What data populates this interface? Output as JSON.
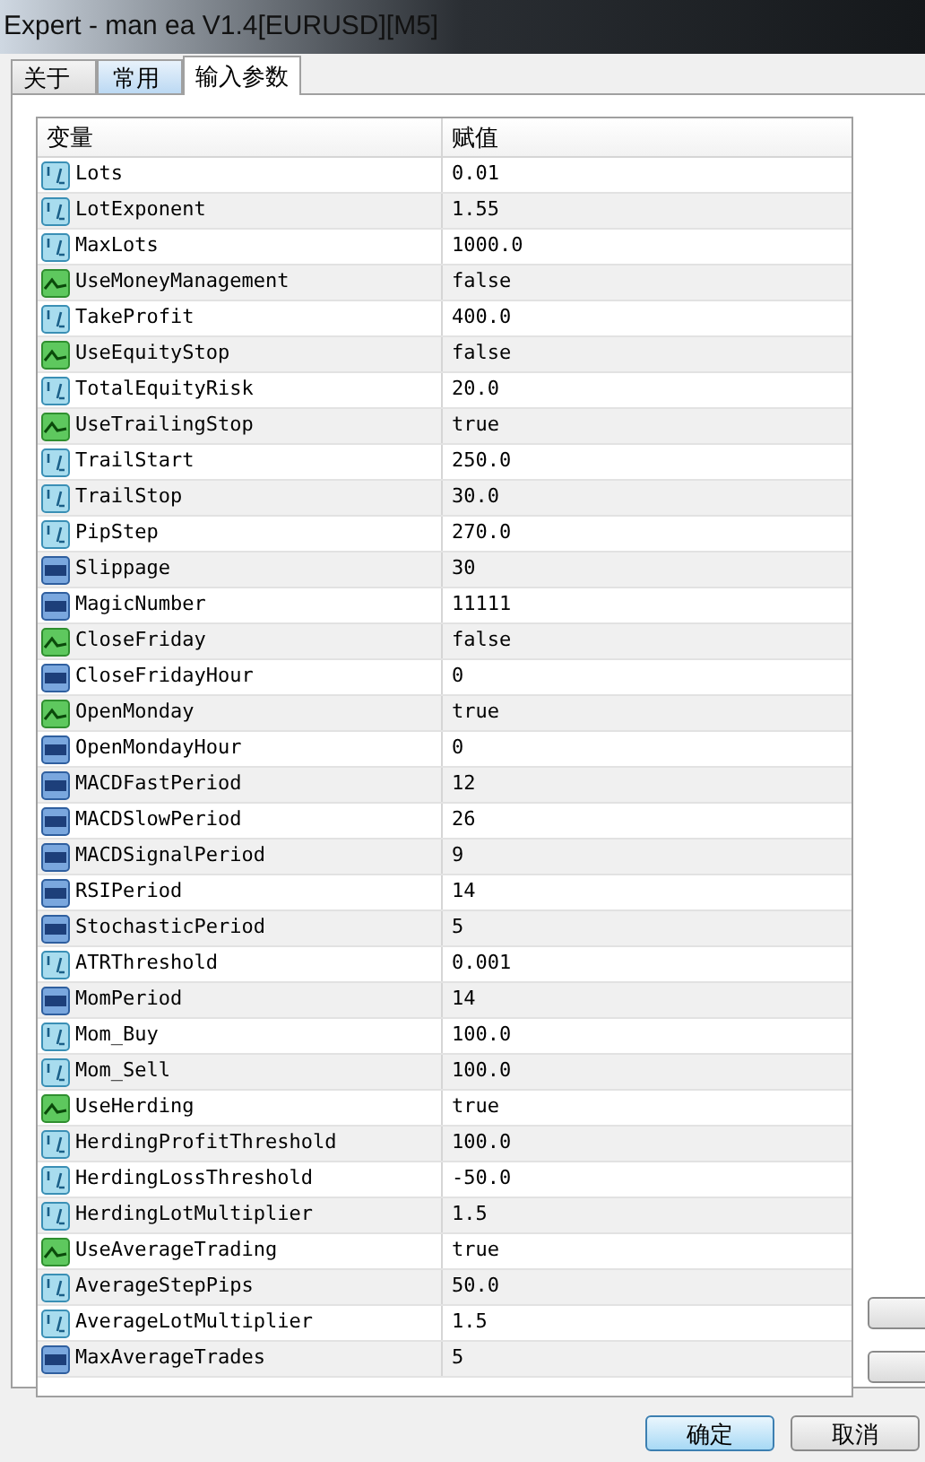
{
  "window": {
    "title": "Expert - man ea V1.4[EURUSD][M5]"
  },
  "tabs": [
    {
      "label": "关于",
      "selected": false
    },
    {
      "label": "常用",
      "selected": false
    },
    {
      "label": "输入参数",
      "selected": true
    }
  ],
  "table": {
    "columns": [
      "变量",
      "赋值"
    ],
    "rows": [
      {
        "kind": "double",
        "name": "Lots",
        "value": "0.01"
      },
      {
        "kind": "double",
        "name": "LotExponent",
        "value": "1.55"
      },
      {
        "kind": "double",
        "name": "MaxLots",
        "value": "1000.0"
      },
      {
        "kind": "bool",
        "name": "UseMoneyManagement",
        "value": "false"
      },
      {
        "kind": "double",
        "name": "TakeProfit",
        "value": "400.0"
      },
      {
        "kind": "bool",
        "name": "UseEquityStop",
        "value": "false"
      },
      {
        "kind": "double",
        "name": "TotalEquityRisk",
        "value": "20.0"
      },
      {
        "kind": "bool",
        "name": "UseTrailingStop",
        "value": "true"
      },
      {
        "kind": "double",
        "name": "TrailStart",
        "value": "250.0"
      },
      {
        "kind": "double",
        "name": "TrailStop",
        "value": "30.0"
      },
      {
        "kind": "double",
        "name": "PipStep",
        "value": "270.0"
      },
      {
        "kind": "int",
        "name": "Slippage",
        "value": "30"
      },
      {
        "kind": "int",
        "name": "MagicNumber",
        "value": "11111"
      },
      {
        "kind": "bool",
        "name": "CloseFriday",
        "value": "false"
      },
      {
        "kind": "int",
        "name": "CloseFridayHour",
        "value": "0"
      },
      {
        "kind": "bool",
        "name": "OpenMonday",
        "value": "true"
      },
      {
        "kind": "int",
        "name": "OpenMondayHour",
        "value": "0"
      },
      {
        "kind": "int",
        "name": "MACDFastPeriod",
        "value": "12"
      },
      {
        "kind": "int",
        "name": "MACDSlowPeriod",
        "value": "26"
      },
      {
        "kind": "int",
        "name": "MACDSignalPeriod",
        "value": "9"
      },
      {
        "kind": "int",
        "name": "RSIPeriod",
        "value": "14"
      },
      {
        "kind": "int",
        "name": "StochasticPeriod",
        "value": "5"
      },
      {
        "kind": "double",
        "name": "ATRThreshold",
        "value": "0.001"
      },
      {
        "kind": "int",
        "name": "MomPeriod",
        "value": "14"
      },
      {
        "kind": "double",
        "name": "Mom_Buy",
        "value": "100.0"
      },
      {
        "kind": "double",
        "name": "Mom_Sell",
        "value": "100.0"
      },
      {
        "kind": "bool",
        "name": "UseHerding",
        "value": "true"
      },
      {
        "kind": "double",
        "name": "HerdingProfitThreshold",
        "value": "100.0"
      },
      {
        "kind": "double",
        "name": "HerdingLossThreshold",
        "value": "-50.0"
      },
      {
        "kind": "double",
        "name": "HerdingLotMultiplier",
        "value": "1.5"
      },
      {
        "kind": "bool",
        "name": "UseAverageTrading",
        "value": "true"
      },
      {
        "kind": "double",
        "name": "AverageStepPips",
        "value": "50.0"
      },
      {
        "kind": "double",
        "name": "AverageLotMultiplier",
        "value": "1.5"
      },
      {
        "kind": "int",
        "name": "MaxAverageTrades",
        "value": "5"
      }
    ]
  },
  "buttons": [
    "确定",
    "取消"
  ]
}
